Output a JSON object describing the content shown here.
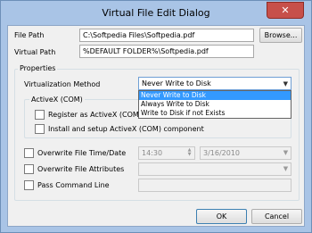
{
  "window": {
    "title": "Virtual File Edit Dialog",
    "close_glyph": "✕"
  },
  "file_path": {
    "label": "File Path",
    "value": "C:\\Softpedia Files\\Softpedia.pdf",
    "browse_label": "Browse..."
  },
  "virtual_path": {
    "label": "Virtual Path",
    "value": "%DEFAULT FOLDER%\\Softpedia.pdf"
  },
  "properties": {
    "group_label": "Properties",
    "virtualization_label": "Virtualization Method",
    "virtualization_selected": "Never Write to Disk",
    "virtualization_options": [
      "Never Write to Disk",
      "Always Write to Disk",
      "Write to Disk if not Exists"
    ],
    "activex_group_label": "ActiveX (COM)",
    "register_activex_label": "Register as ActiveX (COM) component",
    "install_activex_label": "Install and setup ActiveX (COM) component"
  },
  "overwrite_time": {
    "label": "Overwrite File Time/Date",
    "time_value": "14:30",
    "date_value": "3/16/2010"
  },
  "overwrite_attributes": {
    "label": "Overwrite File Attributes"
  },
  "pass_command_line": {
    "label": "Pass Command Line"
  },
  "footer": {
    "ok_label": "OK",
    "cancel_label": "Cancel"
  }
}
